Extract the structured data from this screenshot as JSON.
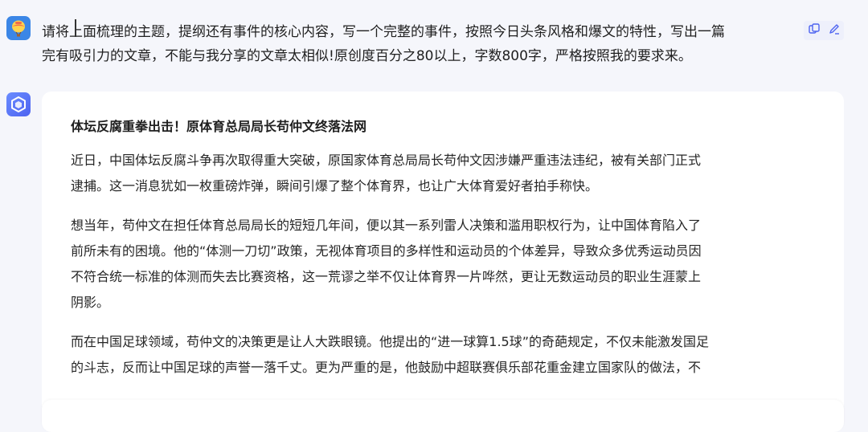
{
  "user_message": {
    "lines": [
      "请将上面梳理的主题，提纲还有事件的核心内容，写一个完整的事件，按照今日头条风格和爆文的特性，写出一篇",
      "完有吸引力的文章，不能与我分享的文章太相似!原创度百分之80以上，字数800字，严格按照我的要求来。"
    ],
    "avatar_icon": "balloon-avatar-icon",
    "actions": [
      "copy-icon",
      "edit-icon"
    ]
  },
  "assistant_reply": {
    "avatar_icon": "hexagon-bot-icon",
    "title": "体坛反腐重拳出击！原体育总局局长苟仲文终落法网",
    "paragraphs": [
      {
        "lines": [
          "近日，中国体坛反腐斗争再次取得重大突破，原国家体育总局局长苟仲文因涉嫌严重违法违纪，被有关部门正式",
          "逮捕。这一消息犹如一枚重磅炸弹，瞬间引爆了整个体育界，也让广大体育爱好者拍手称快。"
        ]
      },
      {
        "lines": [
          "想当年，苟仲文在担任体育总局局长的短短几年间，便以其一系列雷人决策和滥用职权行为，让中国体育陷入了",
          "前所未有的困境。他的“体测一刀切”政策，无视体育项目的多样性和运动员的个体差异，导致众多优秀运动员因",
          "不符合统一标准的体测而失去比赛资格，这一荒谬之举不仅让体育界一片哗然，更让无数运动员的职业生涯蒙上",
          "阴影。"
        ]
      },
      {
        "lines": [
          "而在中国足球领域，苟仲文的决策更是让人大跌眼镜。他提出的“进一球算1.5球”的奇葩规定，不仅未能激发国足",
          "的斗志，反而让中国足球的声誉一落千丈。更为严重的是，他鼓励中超联赛俱乐部花重金建立国家队的做法，不"
        ]
      }
    ]
  },
  "colors": {
    "background": "#f5f6fb",
    "card": "#ffffff",
    "user_avatar": "#3b86e6",
    "bot_avatar": "#4d63f0",
    "action_icon": "#4d63f0"
  }
}
